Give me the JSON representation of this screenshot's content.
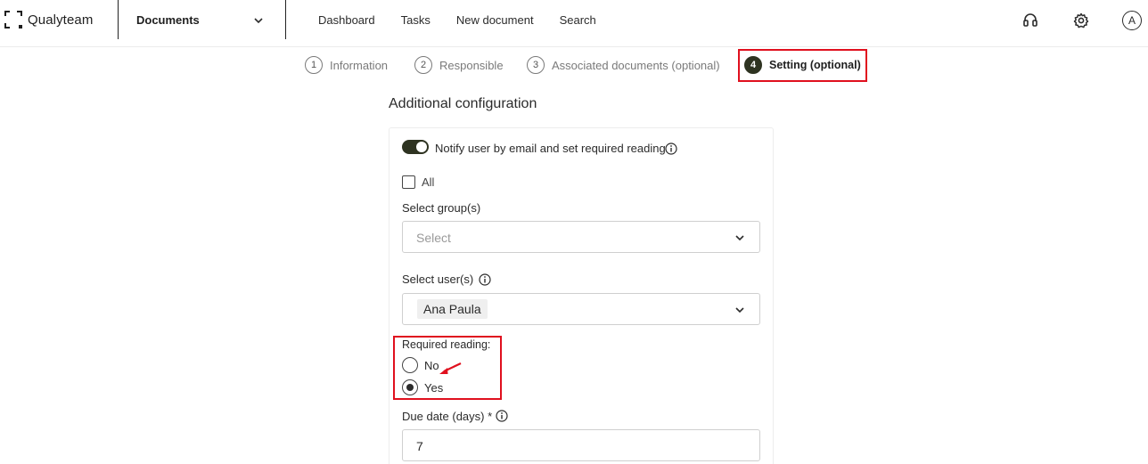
{
  "app": {
    "brand": "Qualyteam",
    "module": "Documents"
  },
  "nav": {
    "items": [
      "Dashboard",
      "Tasks",
      "New document",
      "Search"
    ]
  },
  "user": {
    "avatar_initial": "A"
  },
  "icons": {
    "support": "headset-icon",
    "settings": "gear-icon",
    "info": "info-icon",
    "chevron": "chevron-down-icon"
  },
  "stepper": {
    "steps": [
      {
        "number": "1",
        "label": "Information",
        "state": "inactive"
      },
      {
        "number": "2",
        "label": "Responsible",
        "state": "inactive"
      },
      {
        "number": "3",
        "label": "Associated documents (optional)",
        "state": "inactive"
      },
      {
        "number": "4",
        "label": "Setting (optional)",
        "state": "active"
      }
    ]
  },
  "config": {
    "title": "Additional configuration",
    "notify_label": "Notify user by email and set required reading",
    "notify_enabled": true,
    "all_label": "All",
    "all_checked": false,
    "groups_label": "Select group(s)",
    "groups_placeholder": "Select",
    "users_label": "Select user(s)",
    "selected_users": [
      "Ana Paula"
    ],
    "required_reading_label": "Required reading:",
    "required_reading_options": [
      "No",
      "Yes"
    ],
    "required_reading_selected": "Yes",
    "due_date_label": "Due date (days) *",
    "due_date_value": "7"
  },
  "colors": {
    "accent": "#2e3321",
    "highlight": "#e0101e"
  }
}
